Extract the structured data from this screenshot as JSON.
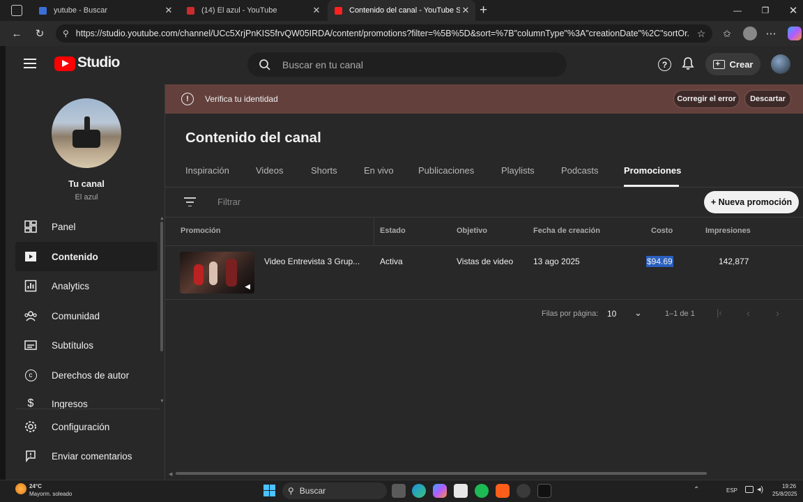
{
  "browser": {
    "tabs": [
      {
        "title": "yutube - Buscar",
        "fav_color": "#3b6fd8",
        "active": false
      },
      {
        "title": "(14) El azul - YouTube",
        "fav_color": "#cc2b2b",
        "active": false
      },
      {
        "title": "Contenido del canal - YouTube St",
        "fav_color": "#ff2020",
        "active": true
      }
    ],
    "new_tab": "+",
    "url": "https://studio.youtube.com/channel/UCc5XrjPnKIS5frvQW05IRDA/content/promotions?filter=%5B%5D&sort=%7B\"columnType\"%3A\"creationDate\"%2C\"sortOr..."
  },
  "header": {
    "logo_text": "Studio",
    "search_placeholder": "Buscar en tu canal",
    "create_label": "Crear"
  },
  "sidebar": {
    "channel_name": "Tu canal",
    "channel_sub": "El azul",
    "items": [
      {
        "label": "Panel",
        "icon": "dashboard-icon"
      },
      {
        "label": "Contenido",
        "icon": "content-icon",
        "selected": true
      },
      {
        "label": "Analytics",
        "icon": "analytics-icon"
      },
      {
        "label": "Comunidad",
        "icon": "community-icon"
      },
      {
        "label": "Subtítulos",
        "icon": "subtitles-icon"
      },
      {
        "label": "Derechos de autor",
        "icon": "copyright-icon"
      },
      {
        "label": "Ingresos",
        "icon": "dollar-icon"
      }
    ],
    "bottom_items": [
      {
        "label": "Configuración",
        "icon": "gear-icon"
      },
      {
        "label": "Enviar comentarios",
        "icon": "feedback-icon"
      }
    ]
  },
  "banner": {
    "text": "Verifica tu identidad",
    "fix_label": "Corregir el error",
    "dismiss_label": "Descartar"
  },
  "content": {
    "title": "Contenido del canal",
    "tabs": [
      "Inspiración",
      "Videos",
      "Shorts",
      "En vivo",
      "Publicaciones",
      "Playlists",
      "Podcasts",
      "Promociones"
    ],
    "selected_tab": "Promociones",
    "filter_placeholder": "Filtrar",
    "new_promo_label": "+ Nueva promoción",
    "columns": [
      "Promoción",
      "Estado",
      "Objetivo",
      "Fecha de creación",
      "Costo",
      "Impresiones"
    ],
    "rows": [
      {
        "promotion": "Video Entrevista 3 Grup...",
        "status": "Activa",
        "goal": "Vistas de video",
        "created": "13 ago 2025",
        "cost": "$94.69",
        "impressions": "142,877"
      }
    ],
    "pagination": {
      "rows_label": "Filas por página:",
      "rows_value": "10",
      "range": "1–1 de 1"
    }
  },
  "taskbar": {
    "weather_temp": "24°C",
    "weather_text": "Mayorm. soleado",
    "search_label": "Buscar",
    "lang": "ESP",
    "time": "19:26",
    "date": "25/8/2025"
  }
}
